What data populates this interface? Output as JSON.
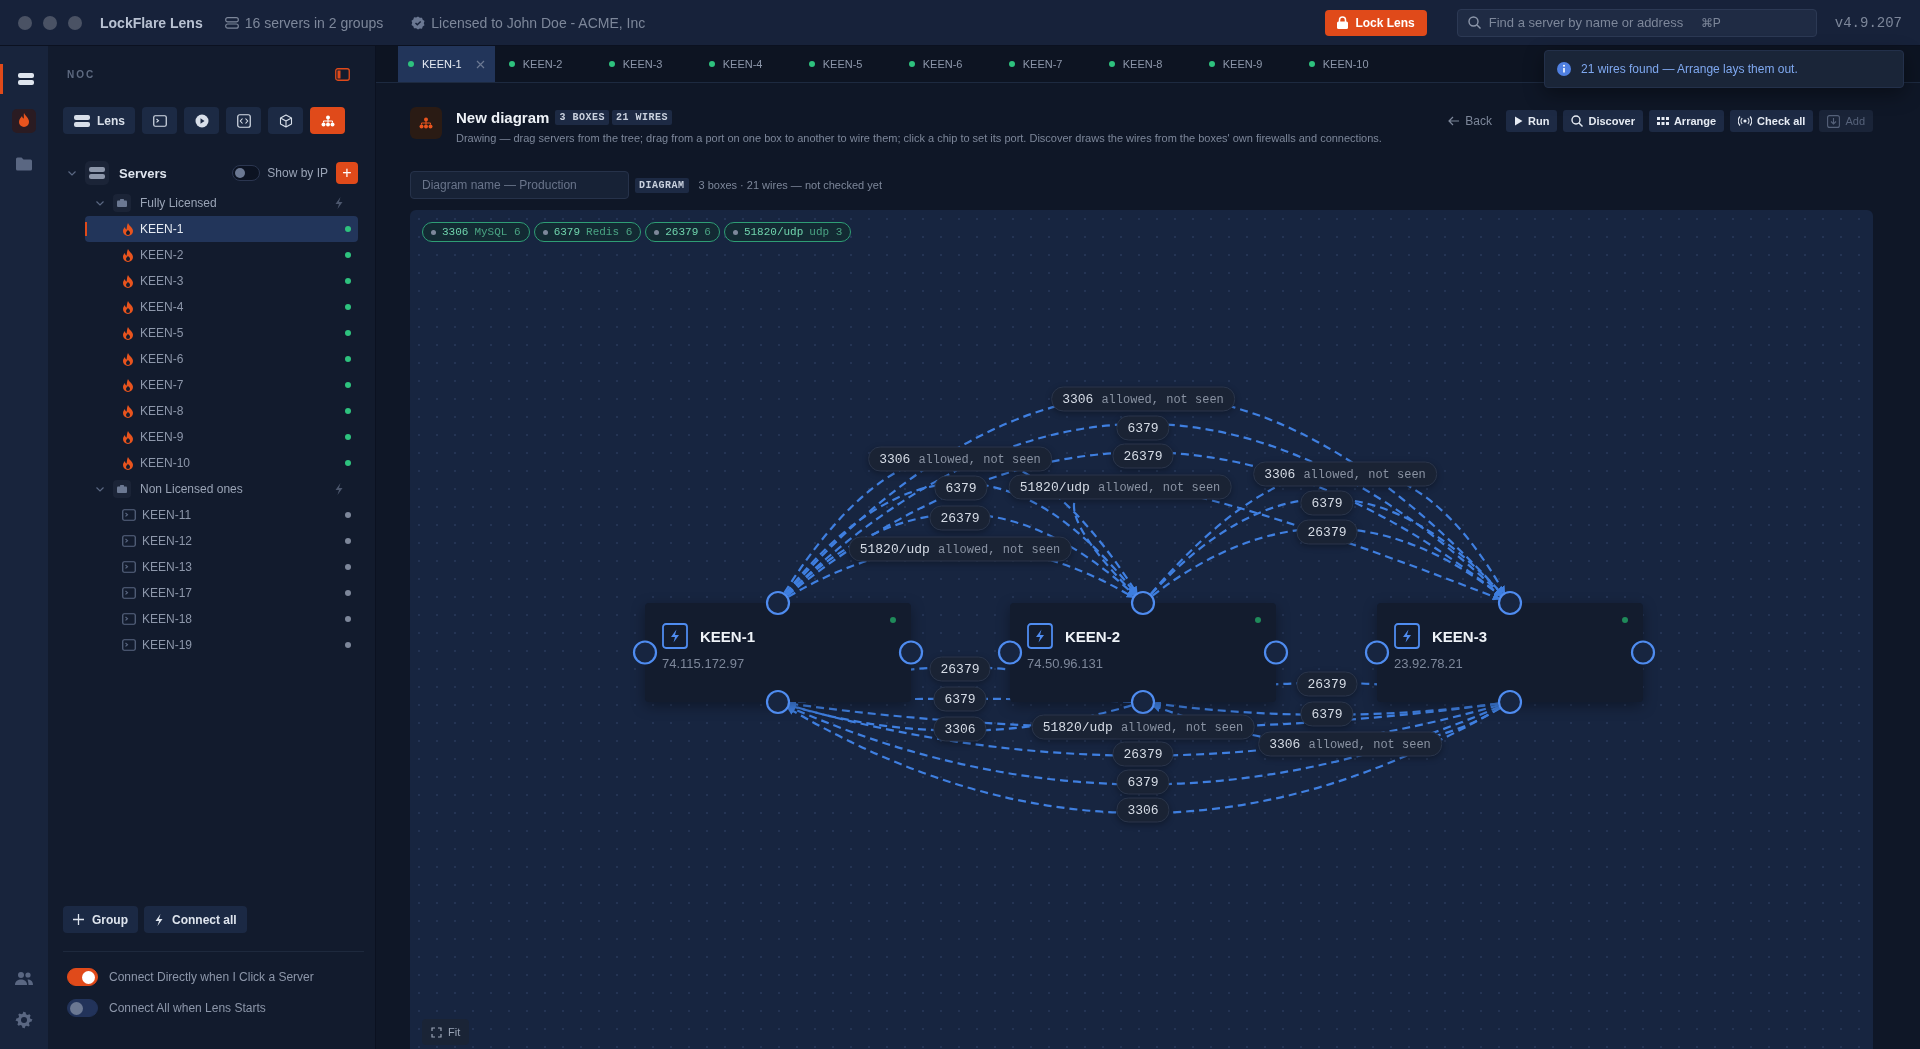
{
  "window": {
    "title": "LockFlare Lens",
    "server_summary": "16 servers in 2 groups",
    "license": "Licensed to John Doe - ACME, Inc",
    "lock_button": "Lock Lens",
    "search": {
      "placeholder": "Find a server by name or address",
      "shortcut": "⌘P"
    },
    "version": "v4.9.207"
  },
  "rail": [
    {
      "kind": "servers",
      "selected": true
    },
    {
      "kind": "app",
      "selected": false
    },
    {
      "kind": "folder",
      "selected": false
    },
    {
      "kind": "people",
      "selected": false
    },
    {
      "kind": "settings",
      "selected": false
    }
  ],
  "sidebar": {
    "title": "NOC",
    "toolbar": [
      {
        "kind": "lens",
        "label": "Lens",
        "selected": false
      },
      {
        "kind": "terminal",
        "selected": false
      },
      {
        "kind": "play",
        "selected": false
      },
      {
        "kind": "code",
        "selected": false
      },
      {
        "kind": "package",
        "selected": false
      },
      {
        "kind": "diagram",
        "selected": true
      }
    ],
    "tree": {
      "label": "Servers",
      "expanded": true,
      "show_by_ip": {
        "label": "Show by IP",
        "on": false
      },
      "add_button": "+",
      "children": [
        {
          "label": "Fully Licensed",
          "kind": "licensed",
          "expanded": true,
          "children": [
            {
              "label": "KEEN-1",
              "selected": true,
              "online": true
            },
            {
              "label": "KEEN-2",
              "selected": false,
              "online": true
            },
            {
              "label": "KEEN-3",
              "selected": false,
              "online": true
            },
            {
              "label": "KEEN-4",
              "selected": false,
              "online": true
            },
            {
              "label": "KEEN-5",
              "selected": false,
              "online": true
            },
            {
              "label": "KEEN-6",
              "selected": false,
              "online": true
            },
            {
              "label": "KEEN-7",
              "selected": false,
              "online": true
            },
            {
              "label": "KEEN-8",
              "selected": false,
              "online": true
            },
            {
              "label": "KEEN-9",
              "selected": false,
              "online": true
            },
            {
              "label": "KEEN-10",
              "selected": false,
              "online": true
            }
          ]
        },
        {
          "label": "Non Licensed ones",
          "kind": "unlicensed",
          "expanded": true,
          "children": [
            {
              "label": "KEEN-11",
              "selected": false,
              "online": false
            },
            {
              "label": "KEEN-12",
              "selected": false,
              "online": false
            },
            {
              "label": "KEEN-13",
              "selected": false,
              "online": false
            },
            {
              "label": "KEEN-17",
              "selected": false,
              "online": false
            },
            {
              "label": "KEEN-18",
              "selected": false,
              "online": false
            },
            {
              "label": "KEEN-19",
              "selected": false,
              "online": false
            }
          ]
        }
      ]
    },
    "buttons": [
      {
        "kind": "add",
        "label": "Group"
      },
      {
        "kind": "connect",
        "label": "Connect all"
      }
    ],
    "settings": [
      {
        "label": "Connect Directly when I Click a Server",
        "on": true
      },
      {
        "label": "Connect All when Lens Starts",
        "on": false
      }
    ]
  },
  "tabs": [
    {
      "label": "KEEN-1",
      "selected": true
    },
    {
      "label": "KEEN-2",
      "selected": false
    },
    {
      "label": "KEEN-3",
      "selected": false
    },
    {
      "label": "KEEN-4",
      "selected": false
    },
    {
      "label": "KEEN-5",
      "selected": false
    },
    {
      "label": "KEEN-6",
      "selected": false
    },
    {
      "label": "KEEN-7",
      "selected": false
    },
    {
      "label": "KEEN-8",
      "selected": false
    },
    {
      "label": "KEEN-9",
      "selected": false
    },
    {
      "label": "KEEN-10",
      "selected": false
    }
  ],
  "toast": {
    "text": "21 wires found — Arrange lays them out."
  },
  "diagram": {
    "title": "New diagram",
    "badges": [
      "3 BOXES",
      "21 WIRES"
    ],
    "description": "Drawing — drag servers from the tree; drag from a port on one box to another to wire them; click a chip to set its port. Discover draws the wires from the boxes' own firewalls and connections.",
    "actions": [
      {
        "kind": "back",
        "label": "Back",
        "disabled": false
      },
      {
        "kind": "run",
        "label": "Run",
        "disabled": false
      },
      {
        "kind": "discover",
        "label": "Discover",
        "disabled": false
      },
      {
        "kind": "arrange",
        "label": "Arrange",
        "disabled": false
      },
      {
        "kind": "check",
        "label": "Check all",
        "disabled": false
      },
      {
        "kind": "add",
        "label": "Add",
        "disabled": true
      }
    ],
    "name_field": {
      "placeholder": "Diagram name — Production"
    },
    "mode_badge": "DIAGRAM",
    "status": "3 boxes · 21 wires — not checked yet",
    "chips": [
      {
        "port": "3306",
        "service": "MySQL",
        "count": "6"
      },
      {
        "port": "6379",
        "service": "Redis",
        "count": "6"
      },
      {
        "port": "26379",
        "count": "6"
      },
      {
        "port": "51820/udp",
        "service": "udp",
        "count": "3"
      }
    ],
    "boxes": [
      {
        "name": "KEEN-1",
        "address": "74.115.172.97",
        "online": true
      },
      {
        "name": "KEEN-2",
        "address": "74.50.96.131",
        "online": true
      },
      {
        "name": "KEEN-3",
        "address": "23.92.78.21",
        "online": true
      }
    ],
    "wires": [
      {
        "port": "3306",
        "note": "allowed, not seen"
      },
      {
        "port": "6379"
      },
      {
        "port": "26379"
      },
      {
        "port": "3306",
        "note": "allowed, not seen"
      },
      {
        "port": "6379"
      },
      {
        "port": "26379"
      },
      {
        "port": "51820/udp",
        "note": "allowed, not seen"
      },
      {
        "port": "51820/udp",
        "note": "allowed, not seen"
      },
      {
        "port": "3306",
        "note": "allowed, not seen"
      },
      {
        "port": "6379"
      },
      {
        "port": "26379"
      },
      {
        "port": "26379"
      },
      {
        "port": "6379"
      },
      {
        "port": "3306"
      },
      {
        "port": "51820/udp",
        "note": "allowed, not seen"
      },
      {
        "port": "26379"
      },
      {
        "port": "6379"
      },
      {
        "port": "3306"
      },
      {
        "port": "26379"
      },
      {
        "port": "6379"
      },
      {
        "port": "3306",
        "note": "allowed, not seen"
      }
    ],
    "fit_button": "Fit"
  }
}
